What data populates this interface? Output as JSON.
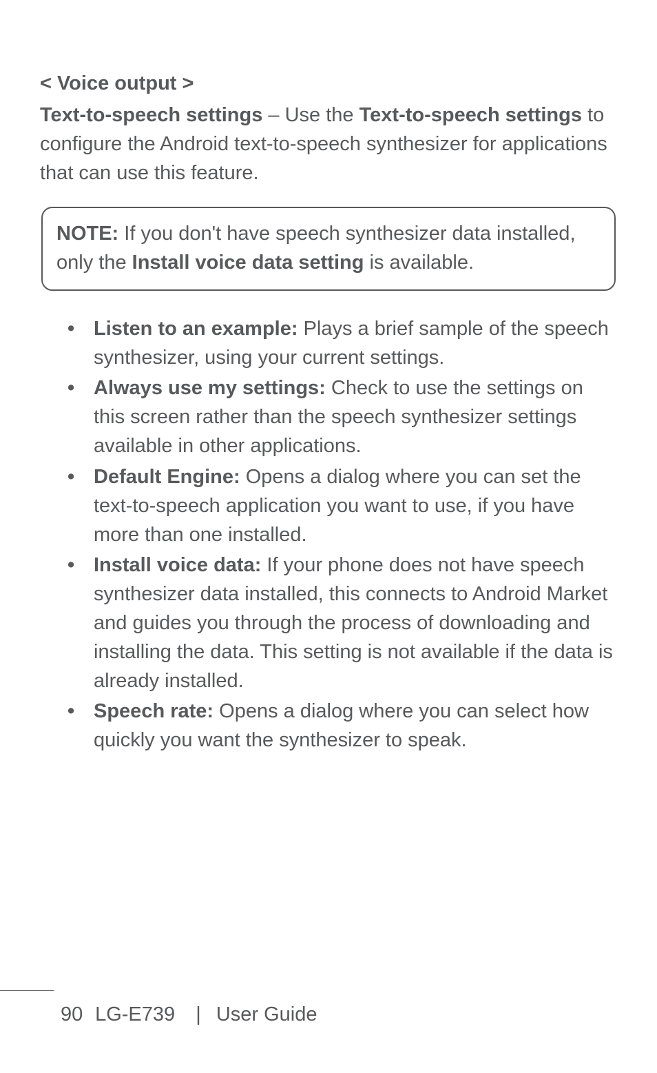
{
  "section": {
    "heading": "< Voice output >",
    "para_parts": {
      "p1": "Text-to-speech settings",
      "p2": " – Use the ",
      "p3": "Text-to-speech settings",
      "p4": " to configure the Android text-to-speech synthesizer for applications that can use this feature."
    }
  },
  "note": {
    "label": "NOTE:",
    "t1": " If you don't have speech synthesizer data installed, only the ",
    "bold": "Install voice data setting",
    "t2": " is available."
  },
  "bullets": [
    {
      "label": "Listen to an example:",
      "text": " Plays a brief sample of the speech synthesizer, using your current settings."
    },
    {
      "label": "Always use my settings:",
      "text": " Check to use the settings on this screen rather than the speech synthesizer settings available in other applications."
    },
    {
      "label": "Default Engine:",
      "text": " Opens a dialog where you can set the text-to-speech application you want to use, if you have more than one installed."
    },
    {
      "label": "Install voice data:",
      "text": " If your phone does not have speech synthesizer data installed, this connects to Android Market and guides you through the process of downloading and installing the data. This setting is not available if the data is already installed."
    },
    {
      "label": "Speech rate:",
      "text": " Opens a dialog where you can select how quickly you want the synthesizer to speak."
    }
  ],
  "footer": {
    "page": "90",
    "model": "LG-E739",
    "sep": "|",
    "guide": "User Guide"
  }
}
